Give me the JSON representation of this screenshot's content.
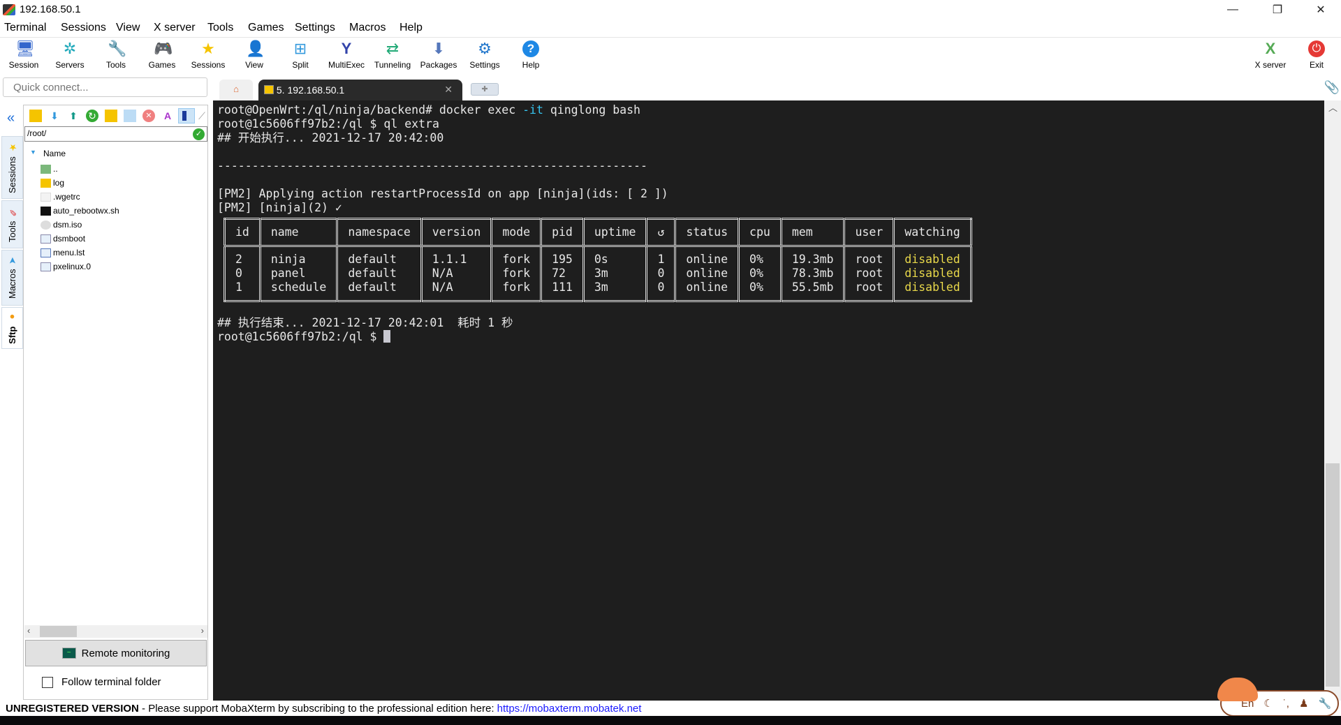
{
  "window": {
    "title": "192.168.50.1",
    "minimize": "—",
    "maximize": "❐",
    "close": "✕"
  },
  "menu": [
    "Terminal",
    "Sessions",
    "View",
    "X server",
    "Tools",
    "Games",
    "Settings",
    "Macros",
    "Help"
  ],
  "toolbar": [
    {
      "label": "Session",
      "icon": "session-icon",
      "glyph": "🖥"
    },
    {
      "label": "Servers",
      "icon": "servers-icon",
      "glyph": "✲"
    },
    {
      "label": "Tools",
      "icon": "tools-icon",
      "glyph": "🔧"
    },
    {
      "label": "Games",
      "icon": "games-icon",
      "glyph": "🎮"
    },
    {
      "label": "Sessions",
      "icon": "star-icon",
      "glyph": "★"
    },
    {
      "label": "View",
      "icon": "view-icon",
      "glyph": "👤"
    },
    {
      "label": "Split",
      "icon": "split-icon",
      "glyph": "⊞"
    },
    {
      "label": "MultiExec",
      "icon": "multiexec-icon",
      "glyph": "Y"
    },
    {
      "label": "Tunneling",
      "icon": "tunneling-icon",
      "glyph": "⇄"
    },
    {
      "label": "Packages",
      "icon": "packages-icon",
      "glyph": "⬇"
    },
    {
      "label": "Settings",
      "icon": "settings-icon",
      "glyph": "⚙"
    },
    {
      "label": "Help",
      "icon": "help-icon",
      "glyph": "?"
    }
  ],
  "toolbar_right": [
    {
      "label": "X server",
      "glyph": "X"
    },
    {
      "label": "Exit",
      "glyph": "⏻"
    }
  ],
  "quick_connect": {
    "placeholder": "Quick connect..."
  },
  "side_tabs": [
    {
      "label": "Sessions",
      "glyph": "★"
    },
    {
      "label": "Tools",
      "glyph": "✎"
    },
    {
      "label": "Macros",
      "glyph": "➤"
    },
    {
      "label": "Sftp",
      "glyph": "●"
    }
  ],
  "collapse_glyph": "«",
  "sftp": {
    "path": "/root/",
    "column": "Name",
    "files": [
      {
        "name": "..",
        "type": "parent"
      },
      {
        "name": "log",
        "type": "folder"
      },
      {
        "name": ".wgetrc",
        "type": "file"
      },
      {
        "name": "auto_rebootwx.sh",
        "type": "script"
      },
      {
        "name": "dsm.iso",
        "type": "disc"
      },
      {
        "name": "dsmboot",
        "type": "file"
      },
      {
        "name": "menu.lst",
        "type": "text"
      },
      {
        "name": "pxelinux.0",
        "type": "file"
      }
    ],
    "remote_monitoring": "Remote monitoring",
    "follow_folder": "Follow terminal folder"
  },
  "tabs": [
    {
      "label": "5. 192.168.50.1",
      "close": "✕"
    }
  ],
  "terminal": {
    "lines_top": [
      "root@OpenWrt:/ql/ninja/backend# docker exec ",
      "-it",
      " qinglong bash",
      "root@1c5606ff97b2:/ql $ ql extra",
      "## 开始执行... 2021-12-17 20:42:00",
      "",
      "--------------------------------------------------------------",
      "",
      "[PM2] Applying action restartProcessId on app [ninja](ids: [ 2 ])",
      "[PM2] [ninja](2) ✓"
    ],
    "table": {
      "headers": [
        "id",
        "name",
        "namespace",
        "version",
        "mode",
        "pid",
        "uptime",
        "↺",
        "status",
        "cpu",
        "mem",
        "user",
        "watching"
      ],
      "rows": [
        [
          "2",
          "ninja",
          "default",
          "1.1.1",
          "fork",
          "195",
          "0s",
          "1",
          "online",
          "0%",
          "19.3mb",
          "root",
          "disabled"
        ],
        [
          "0",
          "panel",
          "default",
          "N/A",
          "fork",
          "72",
          "3m",
          "0",
          "online",
          "0%",
          "78.3mb",
          "root",
          "disabled"
        ],
        [
          "1",
          "schedule",
          "default",
          "N/A",
          "fork",
          "111",
          "3m",
          "0",
          "online",
          "0%",
          "55.5mb",
          "root",
          "disabled"
        ]
      ]
    },
    "lines_bottom": [
      "## 执行结束... 2021-12-17 20:42:01  耗时 1 秒",
      "root@1c5606ff97b2:/ql $ "
    ]
  },
  "status": {
    "unregistered": "UNREGISTERED VERSION",
    "message": "  -  Please support MobaXterm by subscribing to the professional edition here:  ",
    "link": "https://mobaxterm.mobatek.net"
  },
  "ime": {
    "lang": "En"
  }
}
